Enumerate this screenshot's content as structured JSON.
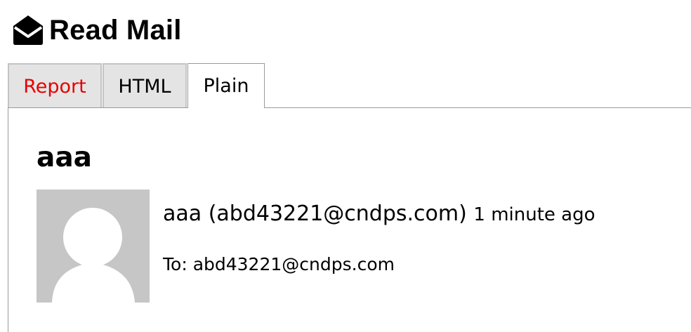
{
  "header": {
    "icon": "envelope-open-icon",
    "title": "Read Mail"
  },
  "tabs": [
    {
      "label": "Report",
      "color": "#e60000",
      "active": false
    },
    {
      "label": "HTML",
      "color": "#000000",
      "active": false
    },
    {
      "label": "Plain",
      "color": "#000000",
      "active": true
    }
  ],
  "message": {
    "subject": "aaa",
    "avatar_icon": "default-user-avatar-icon",
    "sender": "aaa (abd43221@cndps.com)",
    "time": "1 minute ago",
    "to": "To: abd43221@cndps.com"
  }
}
